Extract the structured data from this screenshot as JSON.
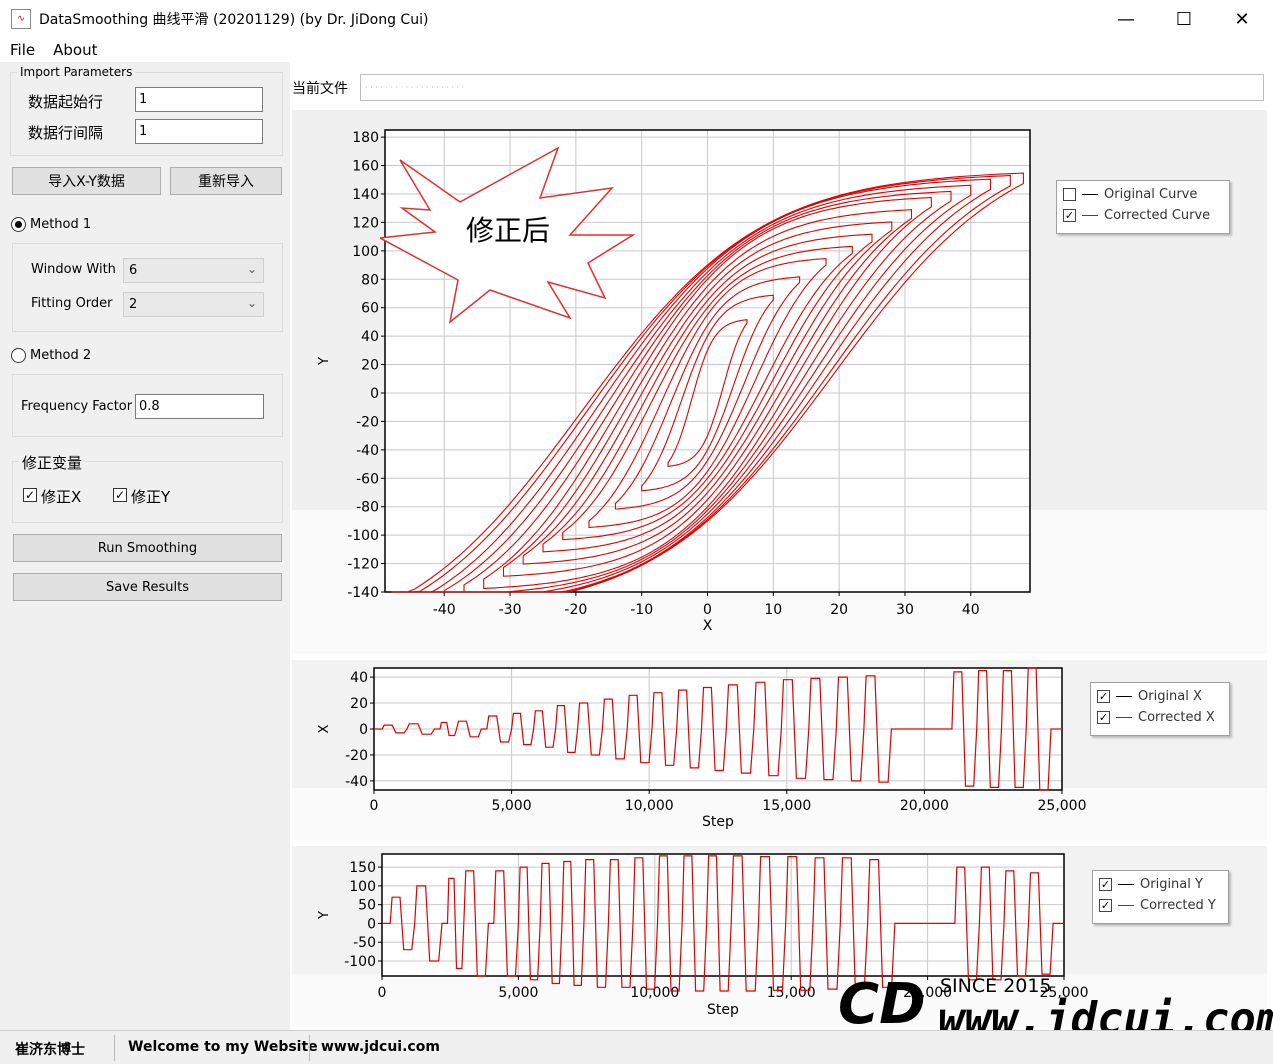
{
  "window": {
    "title": "DataSmoothing 曲线平滑 (20201129) (by Dr. JiDong Cui)",
    "icon_label": "Smooth",
    "controls": {
      "minimize": "—",
      "maximize": "☐",
      "close": "✕"
    }
  },
  "menu": {
    "file": "File",
    "about": "About"
  },
  "import_params": {
    "legend": "Import Parameters",
    "start_row_label": "数据起始行",
    "start_row_value": "1",
    "row_interval_label": "数据行间隔",
    "row_interval_value": "1"
  },
  "buttons": {
    "import_xy": "导入X-Y数据",
    "reimport": "重新导入",
    "run_smoothing": "Run Smoothing",
    "save_results": "Save Results"
  },
  "method1": {
    "label": "Method 1",
    "selected": true,
    "window_label": "Window With",
    "window_value": "6",
    "order_label": "Fitting Order",
    "order_value": "2"
  },
  "method2": {
    "label": "Method 2",
    "selected": false,
    "freq_label": "Frequency Factor",
    "freq_value": "0.8"
  },
  "correct_vars": {
    "legend": "修正变量",
    "x_label": "修正X",
    "x_checked": true,
    "y_label": "修正Y",
    "y_checked": true
  },
  "current_file": {
    "label": "当前文件",
    "value": "· · · · · · ·  ·   ·  · ·  ·  · · ·  · ·  · ·  ·"
  },
  "annotation": {
    "text": "修正后"
  },
  "legends": {
    "xy": [
      {
        "label": "Original Curve",
        "checked": false,
        "color": "#000000"
      },
      {
        "label": "Corrected Curve",
        "checked": true,
        "color": "#e00000"
      }
    ],
    "x": [
      {
        "label": "Original X",
        "checked": true,
        "color": "#000000"
      },
      {
        "label": "Corrected X",
        "checked": true,
        "color": "#e00000"
      }
    ],
    "y": [
      {
        "label": "Original Y",
        "checked": true,
        "color": "#000000"
      },
      {
        "label": "Corrected Y",
        "checked": true,
        "color": "#e00000"
      }
    ]
  },
  "chart_data": [
    {
      "type": "line",
      "id": "xy",
      "xlabel": "X",
      "ylabel": "Y",
      "xlim": [
        -49,
        49
      ],
      "ylim": [
        -140,
        185
      ],
      "xticks": [
        -40,
        -30,
        -20,
        -10,
        0,
        10,
        20,
        30,
        40
      ],
      "yticks": [
        -140,
        -120,
        -100,
        -80,
        -60,
        -40,
        -20,
        0,
        20,
        40,
        60,
        80,
        100,
        120,
        140,
        160,
        180
      ],
      "grid": true,
      "description": "hysteresis loops of increasing amplitude",
      "series": [
        {
          "name": "Corrected Curve",
          "color": "#e00000",
          "loops": [
            {
              "amp": 6,
              "peak": 60
            },
            {
              "amp": 10,
              "peak": 80
            },
            {
              "amp": 14,
              "peak": 95
            },
            {
              "amp": 18,
              "peak": 110
            },
            {
              "amp": 22,
              "peak": 120
            },
            {
              "amp": 25,
              "peak": 130
            },
            {
              "amp": 28,
              "peak": 140
            },
            {
              "amp": 31,
              "peak": 150
            },
            {
              "amp": 34,
              "peak": 160
            },
            {
              "amp": 37,
              "peak": 165
            },
            {
              "amp": 40,
              "peak": 170
            },
            {
              "amp": 43,
              "peak": 175
            },
            {
              "amp": 46,
              "peak": 178
            },
            {
              "amp": 48,
              "peak": 180
            }
          ]
        }
      ]
    },
    {
      "type": "line",
      "id": "x-step",
      "xlabel": "Step",
      "ylabel": "X",
      "xlim": [
        0,
        25000
      ],
      "ylim": [
        -47,
        47
      ],
      "xticks": [
        0,
        5000,
        10000,
        15000,
        20000,
        25000
      ],
      "xticklabels": [
        "0",
        "5,000",
        "10,000",
        "15,000",
        "20,000",
        "25,000"
      ],
      "yticks": [
        -40,
        -20,
        0,
        20,
        40
      ],
      "grid": true,
      "series": [
        {
          "name": "Corrected X",
          "color": "#e00000",
          "cycles": [
            {
              "start": 300,
              "end": 1200,
              "amp": 3
            },
            {
              "start": 1200,
              "end": 2200,
              "amp": 4
            },
            {
              "start": 2400,
              "end": 3000,
              "amp": 5
            },
            {
              "start": 3000,
              "end": 3900,
              "amp": 6
            },
            {
              "start": 4100,
              "end": 5000,
              "amp": 10
            },
            {
              "start": 5000,
              "end": 5800,
              "amp": 12
            },
            {
              "start": 5800,
              "end": 6600,
              "amp": 14
            },
            {
              "start": 6600,
              "end": 7400,
              "amp": 18
            },
            {
              "start": 7400,
              "end": 8300,
              "amp": 20
            },
            {
              "start": 8300,
              "end": 9200,
              "amp": 23
            },
            {
              "start": 9200,
              "end": 10100,
              "amp": 26
            },
            {
              "start": 10100,
              "end": 11000,
              "amp": 28
            },
            {
              "start": 11000,
              "end": 11900,
              "amp": 30
            },
            {
              "start": 11900,
              "end": 12800,
              "amp": 32
            },
            {
              "start": 12800,
              "end": 13800,
              "amp": 34
            },
            {
              "start": 13800,
              "end": 14800,
              "amp": 36
            },
            {
              "start": 14800,
              "end": 15800,
              "amp": 38
            },
            {
              "start": 15800,
              "end": 16800,
              "amp": 39
            },
            {
              "start": 16800,
              "end": 17800,
              "amp": 40
            },
            {
              "start": 17800,
              "end": 18800,
              "amp": 41
            },
            {
              "start": 21000,
              "end": 21900,
              "amp": 44
            },
            {
              "start": 21900,
              "end": 22800,
              "amp": 45
            },
            {
              "start": 22800,
              "end": 23700,
              "amp": 45
            },
            {
              "start": 23700,
              "end": 24600,
              "amp": 47
            }
          ]
        }
      ]
    },
    {
      "type": "line",
      "id": "y-step",
      "xlabel": "Step",
      "ylabel": "Y",
      "xlim": [
        0,
        25000
      ],
      "ylim": [
        -140,
        185
      ],
      "xticks": [
        0,
        5000,
        10000,
        15000,
        20000,
        25000
      ],
      "xticklabels": [
        "0",
        "5,000",
        "10,000",
        "15,000",
        "20,000",
        "25,000"
      ],
      "yticks": [
        -100,
        -50,
        0,
        50,
        100,
        150
      ],
      "grid": true,
      "series": [
        {
          "name": "Corrected Y",
          "color": "#e00000",
          "cycles": [
            {
              "start": 300,
              "end": 1200,
              "amp": 70
            },
            {
              "start": 1200,
              "end": 2200,
              "amp": 100
            },
            {
              "start": 2400,
              "end": 3000,
              "amp": 120
            },
            {
              "start": 3000,
              "end": 3900,
              "amp": 140
            },
            {
              "start": 4100,
              "end": 5000,
              "amp": 140
            },
            {
              "start": 5000,
              "end": 5800,
              "amp": 150
            },
            {
              "start": 5800,
              "end": 6600,
              "amp": 160
            },
            {
              "start": 6600,
              "end": 7400,
              "amp": 165
            },
            {
              "start": 7400,
              "end": 8300,
              "amp": 170
            },
            {
              "start": 8300,
              "end": 9200,
              "amp": 170
            },
            {
              "start": 9200,
              "end": 10100,
              "amp": 175
            },
            {
              "start": 10100,
              "end": 11000,
              "amp": 180
            },
            {
              "start": 11000,
              "end": 11900,
              "amp": 180
            },
            {
              "start": 11900,
              "end": 12800,
              "amp": 180
            },
            {
              "start": 12800,
              "end": 13800,
              "amp": 180
            },
            {
              "start": 13800,
              "end": 14800,
              "amp": 178
            },
            {
              "start": 14800,
              "end": 15800,
              "amp": 178
            },
            {
              "start": 15800,
              "end": 16800,
              "amp": 175
            },
            {
              "start": 16800,
              "end": 17800,
              "amp": 175
            },
            {
              "start": 17800,
              "end": 18800,
              "amp": 170
            },
            {
              "start": 21000,
              "end": 21900,
              "amp": 150
            },
            {
              "start": 21900,
              "end": 22800,
              "amp": 150
            },
            {
              "start": 22800,
              "end": 23700,
              "amp": 140
            },
            {
              "start": 23700,
              "end": 24600,
              "amp": 135
            }
          ]
        }
      ]
    }
  ],
  "statusbar": {
    "author": "崔济东博士",
    "welcome": "Welcome to my Website",
    "site": "www.jdcui.com"
  },
  "watermark": {
    "since": "SINCE 2015",
    "logo": "CD",
    "url": "www.jdcui.com"
  }
}
